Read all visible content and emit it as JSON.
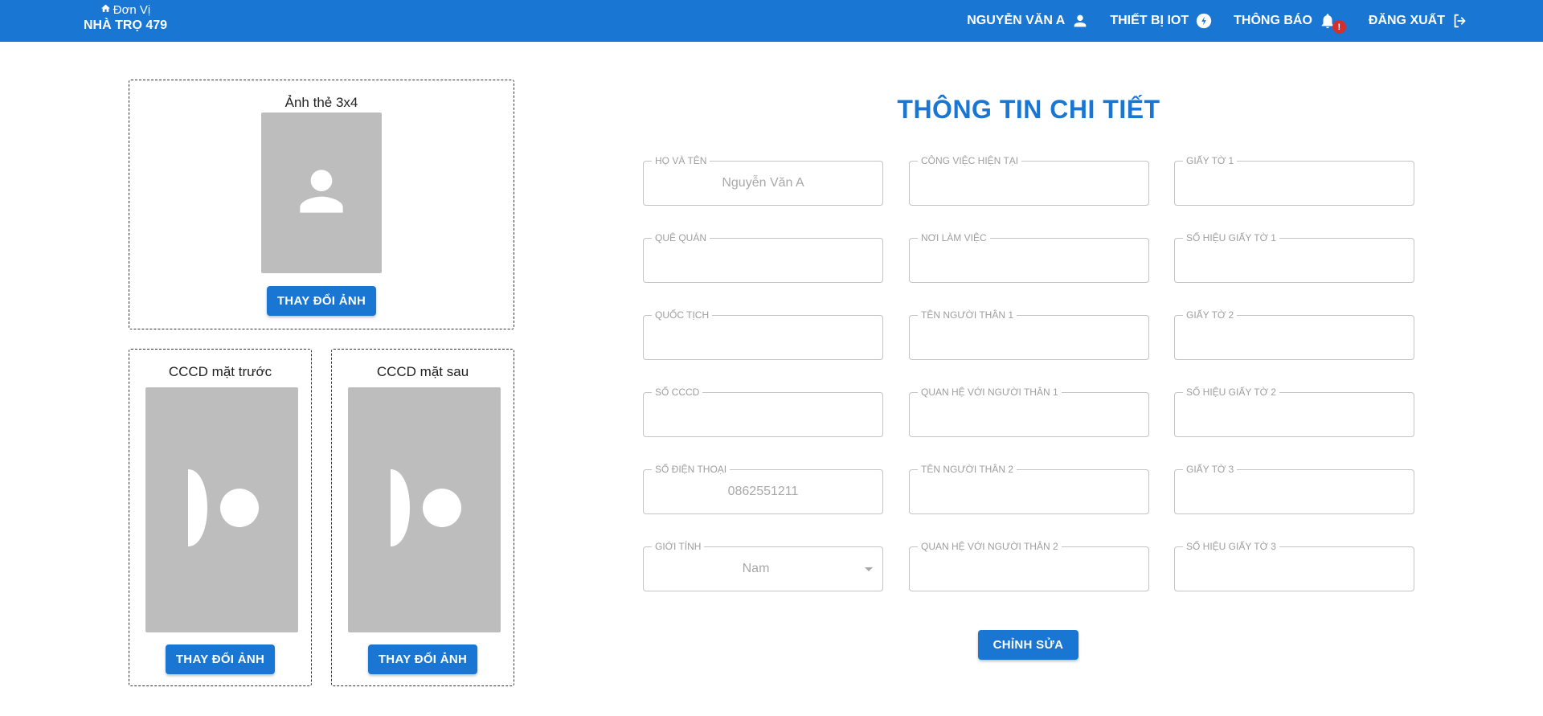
{
  "header": {
    "unit_label": "Đơn Vị",
    "unit_name": "NHÀ TRỌ 479",
    "user_name": "NGUYỄN VĂN A",
    "iot_label": "THIẾT BỊ IOT",
    "notifications_label": "THÔNG BÁO",
    "notifications_badge": "!",
    "logout_label": "ĐĂNG XUẤT",
    "colors": {
      "primary": "#1976d2",
      "badge": "#d32f2f"
    }
  },
  "photos": {
    "portrait": {
      "title": "Ảnh thẻ 3x4",
      "button": "THAY ĐỔI ẢNH"
    },
    "id_front": {
      "title": "CCCD mặt trước",
      "button": "THAY ĐỔI ẢNH"
    },
    "id_back": {
      "title": "CCCD mặt sau",
      "button": "THAY ĐỔI ẢNH"
    },
    "placeholder_color": "#bdbdbd"
  },
  "details": {
    "title": "THÔNG TIN CHI TIẾT",
    "fields": [
      {
        "label": "HỌ VÀ TÊN",
        "value": "Nguyễn Văn A"
      },
      {
        "label": "CÔNG VIỆC HIỆN TẠI",
        "value": ""
      },
      {
        "label": "GIẤY TỜ 1",
        "value": ""
      },
      {
        "label": "QUÊ QUÁN",
        "value": ""
      },
      {
        "label": "NƠI LÀM VIỆC",
        "value": ""
      },
      {
        "label": "SỐ HIỆU GIẤY TỜ 1",
        "value": ""
      },
      {
        "label": "QUỐC TỊCH",
        "value": ""
      },
      {
        "label": "TÊN NGƯỜI THÂN 1",
        "value": ""
      },
      {
        "label": "GIẤY TỜ 2",
        "value": ""
      },
      {
        "label": "SỐ CCCD",
        "value": ""
      },
      {
        "label": "QUAN HỆ VỚI NGƯỜI THÂN 1",
        "value": ""
      },
      {
        "label": "SỐ HIỆU GIẤY TỜ 2",
        "value": ""
      },
      {
        "label": "SỐ ĐIỆN THOẠI",
        "value": "0862551211"
      },
      {
        "label": "TÊN NGƯỜI THÂN 2",
        "value": ""
      },
      {
        "label": "GIẤY TỜ 3",
        "value": ""
      },
      {
        "label": "GIỚI TÍNH",
        "value": "Nam"
      },
      {
        "label": "QUAN HỆ VỚI NGƯỜI THÂN 2",
        "value": ""
      },
      {
        "label": "SỐ HIỆU GIẤY TỜ 3",
        "value": ""
      }
    ],
    "edit_button": "CHỈNH SỬA"
  }
}
